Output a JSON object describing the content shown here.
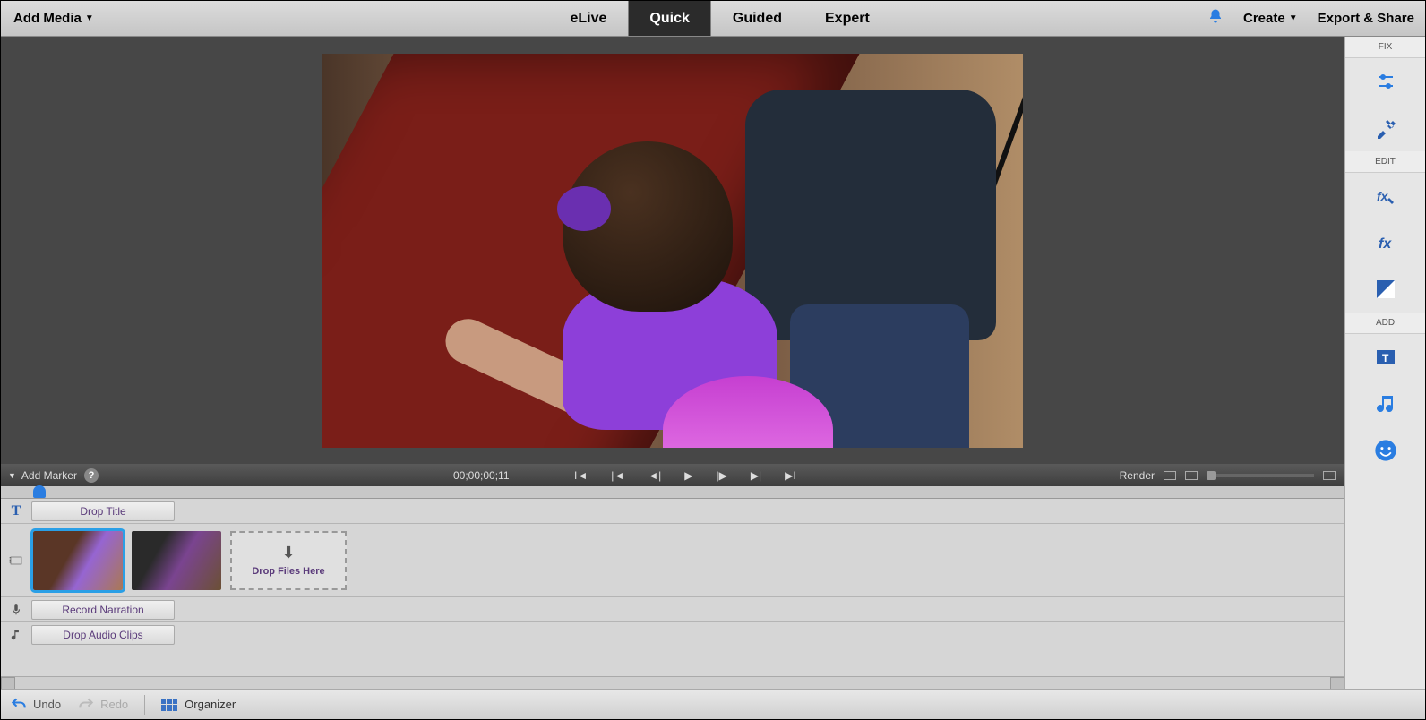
{
  "topbar": {
    "add_media": "Add Media",
    "modes": {
      "elive": "eLive",
      "quick": "Quick",
      "guided": "Guided",
      "expert": "Expert"
    },
    "create": "Create",
    "export": "Export & Share"
  },
  "playbar": {
    "add_marker": "Add Marker",
    "timecode": "00;00;00;11",
    "render": "Render"
  },
  "timeline": {
    "drop_title": "Drop Title",
    "drop_files": "Drop Files Here",
    "record_narration": "Record Narration",
    "drop_audio": "Drop Audio Clips"
  },
  "rightpanel": {
    "fix": "FIX",
    "edit": "EDIT",
    "add": "ADD"
  },
  "bottombar": {
    "undo": "Undo",
    "redo": "Redo",
    "organizer": "Organizer"
  }
}
